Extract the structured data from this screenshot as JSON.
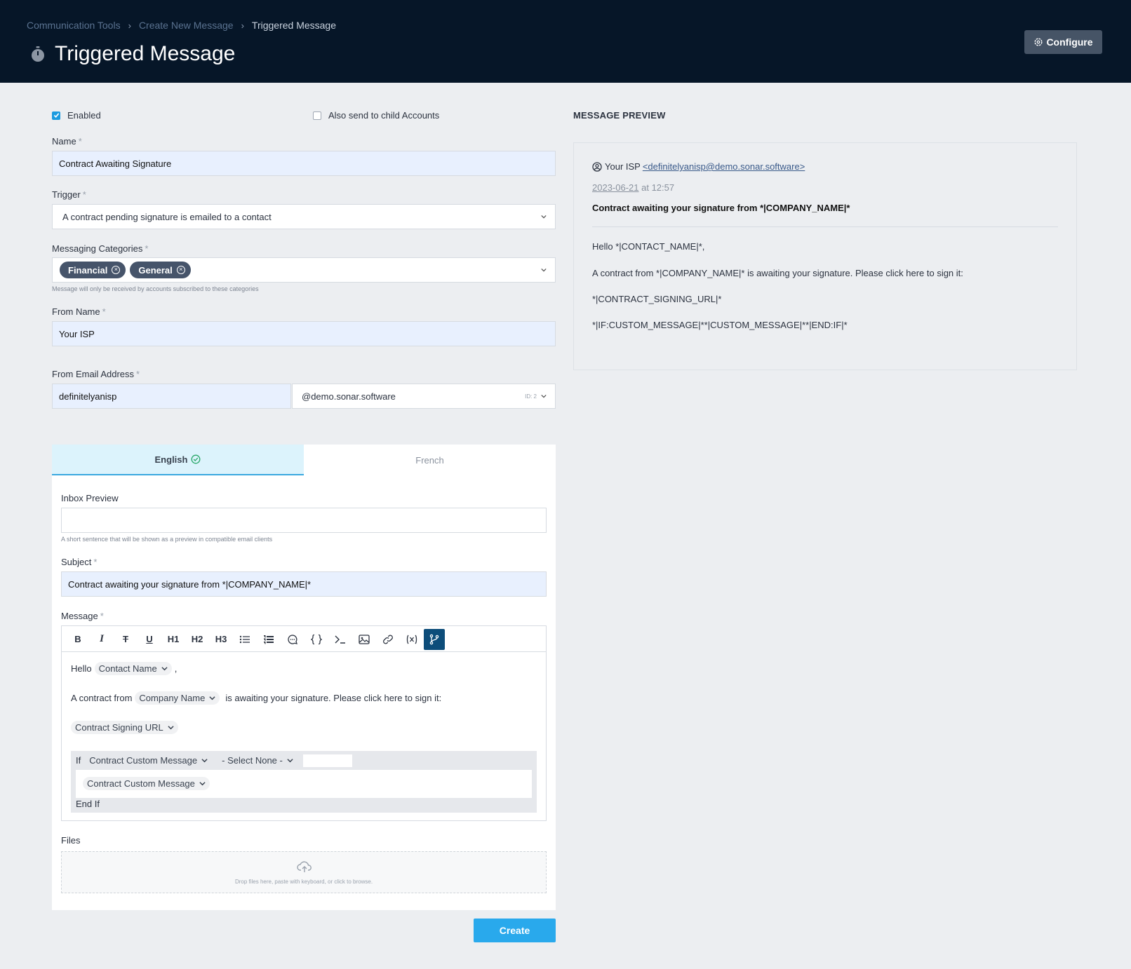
{
  "breadcrumb": {
    "item1": "Communication Tools",
    "item2": "Create New Message",
    "current": "Triggered Message",
    "separator": "›"
  },
  "header": {
    "title": "Triggered Message",
    "configure_label": "Configure"
  },
  "form": {
    "enabled_label": "Enabled",
    "enabled": true,
    "child_accounts_label": "Also send to child Accounts",
    "child_accounts": false,
    "required_marker": "*",
    "name_label": "Name",
    "name_value": "Contract Awaiting Signature",
    "trigger_label": "Trigger",
    "trigger_value": "A contract pending signature is emailed to a contact",
    "categories_label": "Messaging Categories",
    "categories": [
      {
        "label": "Financial"
      },
      {
        "label": "General"
      }
    ],
    "categories_help": "Message will only be received by accounts subscribed to these categories",
    "from_name_label": "From Name",
    "from_name_value": "Your ISP",
    "from_email_label": "From Email Address",
    "from_email_local": "definitelyanisp",
    "from_email_domain": "@demo.sonar.software",
    "domain_id": "ID: 2"
  },
  "tabs": [
    {
      "label": "English",
      "active": true
    },
    {
      "label": "French",
      "active": false
    }
  ],
  "content": {
    "inbox_preview_label": "Inbox Preview",
    "inbox_preview_value": "",
    "inbox_preview_help": "A short sentence that will be shown as a preview in compatible email clients",
    "subject_label": "Subject",
    "subject_value": "Contract awaiting your signature from *|COMPANY_NAME|*",
    "message_label": "Message",
    "toolbar": [
      "B",
      "I",
      "T",
      "U",
      "H1",
      "H2",
      "H3"
    ],
    "editor": {
      "hello": "Hello",
      "contact_token": "Contact Name",
      "comma": ",",
      "contract_from": "A contract from",
      "company_token": "Company Name",
      "awaiting": "is awaiting your signature. Please click here to sign it:",
      "signing_token": "Contract Signing URL",
      "if_label": "If",
      "if_token": "Contract Custom Message",
      "select_none": "- Select None -",
      "inner_token": "Contract Custom Message",
      "end_if": "End If"
    },
    "files_label": "Files",
    "files_help": "Drop files here, paste with keyboard, or click to browse."
  },
  "create_label": "Create",
  "preview": {
    "title": "MESSAGE PREVIEW",
    "from_name": "Your ISP",
    "from_email": "<definitelyanisp@demo.sonar.software>",
    "date": "2023-06-21",
    "time": "at 12:57",
    "subject": "Contract awaiting your signature from *|COMPANY_NAME|*",
    "line1": "Hello *|CONTACT_NAME|*,",
    "line2": "A contract from *|COMPANY_NAME|* is awaiting your signature. Please click here to sign it:",
    "line3": "*|CONTRACT_SIGNING_URL|*",
    "line4": "*|IF:CUSTOM_MESSAGE|**|CUSTOM_MESSAGE|**|END:IF|*"
  },
  "colors": {
    "header_bg": "#061628",
    "accent": "#29a9ec",
    "pill": "#46546a",
    "active_tool": "#0d4d7a"
  }
}
